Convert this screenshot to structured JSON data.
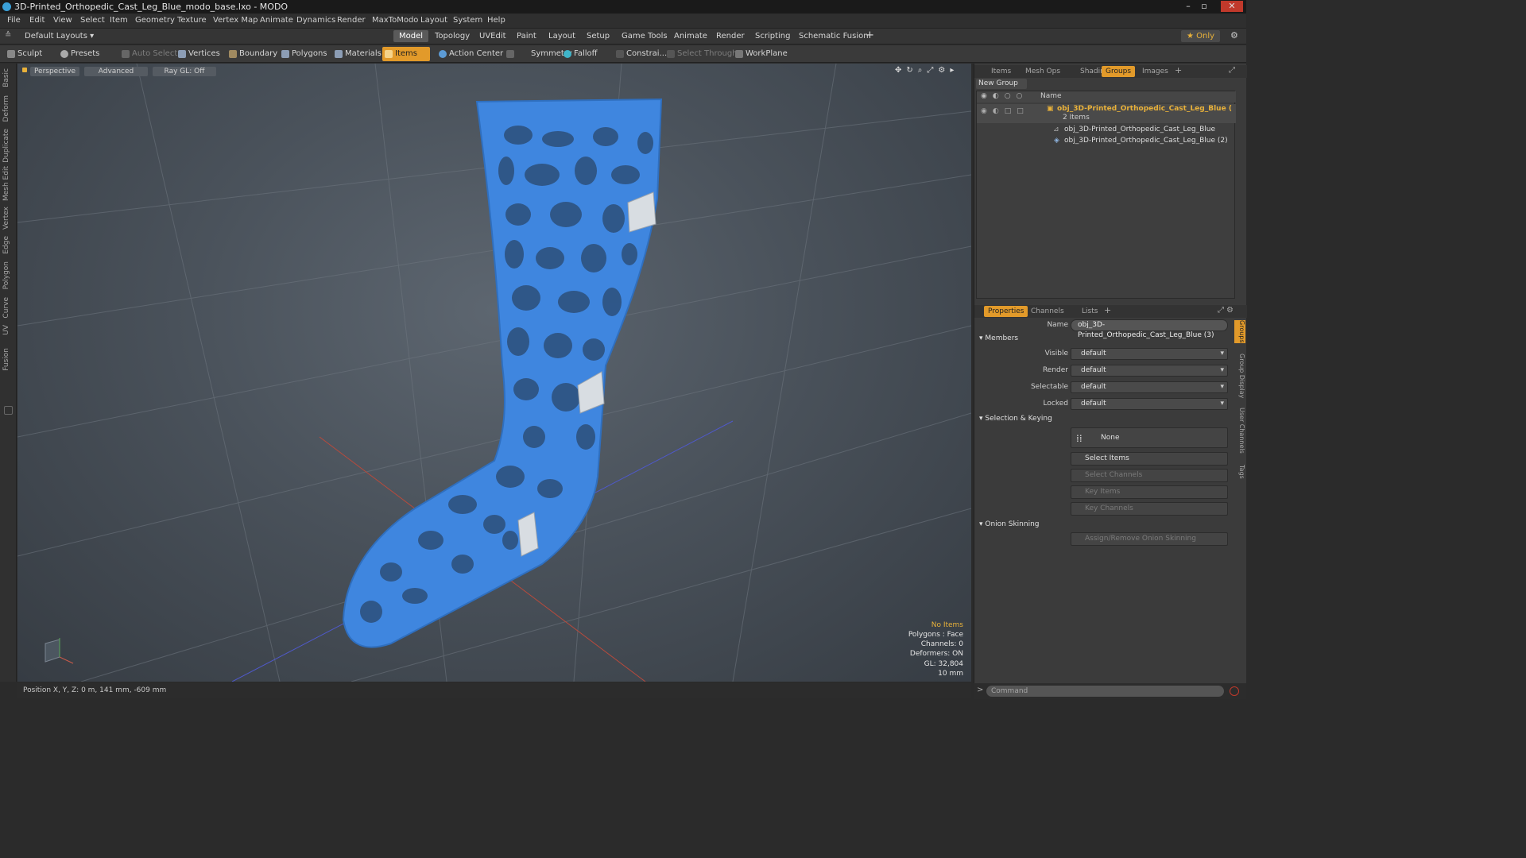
{
  "window": {
    "title": "3D-Printed_Orthopedic_Cast_Leg_Blue_modo_base.lxo - MODO"
  },
  "menu": [
    "File",
    "Edit",
    "View",
    "Select",
    "Item",
    "Geometry",
    "Texture",
    "Vertex Map",
    "Animate",
    "Dynamics",
    "Render",
    "MaxToModo",
    "Layout",
    "System",
    "Help"
  ],
  "layout": {
    "preset": "Default Layouts ▾",
    "tabs": [
      "Model",
      "Topology",
      "UVEdit",
      "Paint",
      "Layout",
      "Setup",
      "Game Tools",
      "Animate",
      "Render",
      "Scripting",
      "Schematic Fusion"
    ],
    "active_tab": "Model",
    "only_label": "★ Only"
  },
  "toolbar": {
    "sculpt": "Sculpt",
    "presets": "Presets",
    "auto_select": "Auto Select",
    "vertices": "Vertices",
    "boundary": "Boundary",
    "polygons": "Polygons",
    "materials": "Materials",
    "items": "Items",
    "action_center": "Action Center",
    "symmetry": "Symmetry",
    "falloff": "Falloff",
    "constraints": "Constrai...",
    "select_through": "Select Through",
    "workplane": "WorkPlane"
  },
  "left_tabs": [
    "Basic",
    "Deform",
    "Duplicate",
    "Mesh Edit",
    "Vertex",
    "Edge",
    "Polygon",
    "Curve",
    "UV",
    "Fusion"
  ],
  "viewport": {
    "perspective": "Perspective",
    "advanced": "Advanced",
    "raygl": "Ray GL: Off",
    "info": {
      "items": "No Items",
      "polygons": "Polygons : Face",
      "channels": "Channels: 0",
      "deformers": "Deformers: ON",
      "gl": "GL: 32,804",
      "units": "10 mm"
    },
    "model_color": "#3f86df"
  },
  "status": {
    "position": "Position X, Y, Z:  0 m, 141 mm, -609 mm"
  },
  "panel_top": {
    "tabs": [
      "Items",
      "Mesh Ops",
      "Shading",
      "Groups",
      "Images"
    ],
    "active_tab": "Groups",
    "new_group": "New Group",
    "col_name": "Name",
    "group_name": "obj_3D-Printed_Orthopedic_Cast_Leg_Blue (",
    "group_count": "2 Items",
    "children": [
      "obj_3D-Printed_Orthopedic_Cast_Leg_Blue",
      "obj_3D-Printed_Orthopedic_Cast_Leg_Blue (2)"
    ]
  },
  "properties": {
    "tabs": [
      "Properties",
      "Channels",
      "Lists"
    ],
    "active_tab": "Properties",
    "name_label": "Name",
    "name_value": "obj_3D-Printed_Orthopedic_Cast_Leg_Blue (3)",
    "members": "Members",
    "visible_label": "Visible",
    "visible_value": "default",
    "render_label": "Render",
    "render_value": "default",
    "selectable_label": "Selectable",
    "selectable_value": "default",
    "locked_label": "Locked",
    "locked_value": "default",
    "selection_keying": "Selection & Keying",
    "none": "None",
    "select_items": "Select Items",
    "select_channels": "Select Channels",
    "key_items": "Key Items",
    "key_channels": "Key Channels",
    "onion_skinning": "Onion Skinning",
    "assign_onion": "Assign/Remove Onion Skinning",
    "side_tabs": [
      "Groups",
      "Group Display",
      "User Channels",
      "Tags"
    ]
  },
  "command": {
    "placeholder": "Command"
  },
  "colors": {
    "accent": "#e29a2a",
    "highlight": "#e8b13a"
  }
}
